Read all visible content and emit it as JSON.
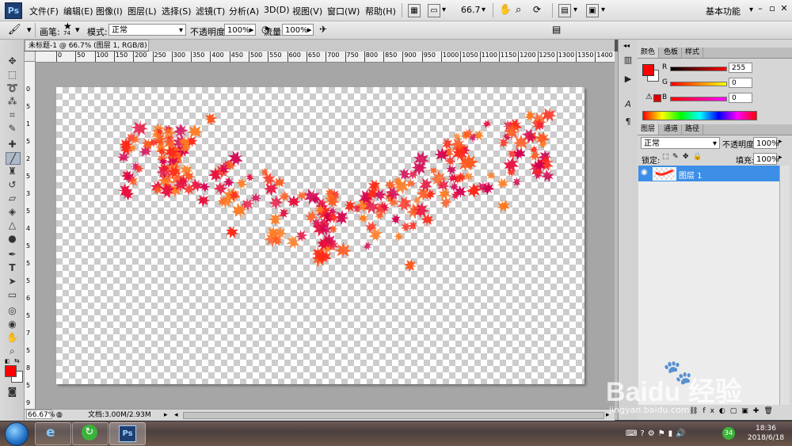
{
  "app": {
    "logo": "Ps"
  },
  "menu": [
    "文件(F)",
    "编辑(E)",
    "图像(I)",
    "图层(L)",
    "选择(S)",
    "滤镜(T)",
    "分析(A)",
    "3D(D)",
    "视图(V)",
    "窗口(W)",
    "帮助(H)"
  ],
  "menubar_tools": {
    "zoom": "66.7",
    "workspace": "基本功能"
  },
  "options": {
    "brush_label": "画笔:",
    "brush_size": "74",
    "mode_label": "模式:",
    "mode_value": "正常",
    "opacity_label": "不透明度:",
    "opacity_value": "100%",
    "flow_label": "流量:",
    "flow_value": "100%"
  },
  "document": {
    "tab_title": "未标题-1 @ 66.7% (图层 1, RGB/8) *",
    "zoom_status": "66.67%",
    "doc_info": "文档:3.00M/2.93M",
    "ruler_h": [
      "0",
      "50",
      "100",
      "150",
      "200",
      "250",
      "300",
      "350",
      "400",
      "450",
      "500",
      "550",
      "600",
      "650",
      "700",
      "750",
      "800",
      "850",
      "900",
      "950",
      "1000",
      "1050",
      "1100",
      "1150",
      "1200",
      "1250",
      "1300",
      "1350",
      "1400"
    ],
    "ruler_v": [
      "0",
      "5",
      "1",
      "5",
      "2",
      "5",
      "3",
      "5",
      "4",
      "5",
      "5",
      "5",
      "6",
      "5",
      "7",
      "5",
      "8",
      "5",
      "9"
    ]
  },
  "color_panel": {
    "tabs": [
      "颜色",
      "色板",
      "样式"
    ],
    "r_label": "R",
    "g_label": "G",
    "b_label": "B",
    "r": "255",
    "g": "0",
    "b": "0",
    "foreground": "#ff0000",
    "background": "#ffffff"
  },
  "layers_panel": {
    "tabs": [
      "图层",
      "通道",
      "路径"
    ],
    "blend_mode": "正常",
    "opacity_label": "不透明度:",
    "opacity_value": "100%",
    "lock_label": "锁定:",
    "fill_label": "填充:",
    "fill_value": "100%",
    "layers": [
      {
        "name": "图层 1",
        "selected": true
      }
    ]
  },
  "taskbar": {
    "ps_label": "Ps",
    "badge": "34",
    "time": "18:36",
    "date": "2018/6/18"
  },
  "watermark": {
    "brand": "Baidu 经验",
    "url": "jingyan.baidu.com"
  },
  "colors": {
    "accent": "#3d8ee6",
    "leaf_palette": [
      "#ff2a1a",
      "#e8123f",
      "#ff5a1f",
      "#d4004f",
      "#ff7a20"
    ]
  }
}
